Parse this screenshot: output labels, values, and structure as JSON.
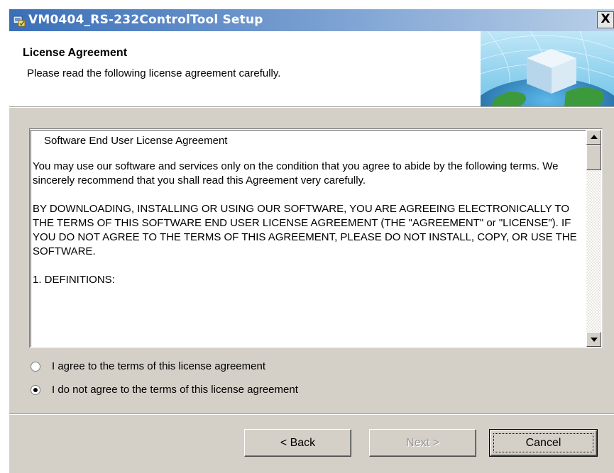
{
  "window": {
    "title": "VM0404_RS-232ControlTool Setup",
    "close_label": "X"
  },
  "header": {
    "heading": "License Agreement",
    "subheading": "Please read the following license agreement carefully."
  },
  "license": {
    "title": "Software End User License Agreement",
    "paragraphs": [
      "You may use our software and services only on the condition that you agree to abide by the following terms. We sincerely recommend that you shall read this Agreement very carefully.",
      "BY DOWNLOADING, INSTALLING OR USING OUR SOFTWARE, YOU ARE AGREEING ELECTRONICALLY TO THE TERMS OF THIS SOFTWARE END USER LICENSE AGREEMENT (THE \"AGREEMENT\" or \"LICENSE\"). IF YOU DO NOT AGREE TO THE TERMS OF THIS AGREEMENT, PLEASE DO NOT INSTALL, COPY, OR USE THE SOFTWARE.",
      "1. DEFINITIONS:"
    ]
  },
  "options": {
    "agree_label": "I agree to the terms of this license agreement",
    "disagree_label": "I do not agree to the terms of this license agreement",
    "selected": "disagree"
  },
  "buttons": {
    "back_label": "< Back",
    "next_label": "Next >",
    "cancel_label": "Cancel",
    "next_enabled": false
  },
  "colors": {
    "titlebar_start": "#3a6fb8",
    "titlebar_end": "#b9cfe8",
    "dialog_face": "#d4d0c8"
  }
}
